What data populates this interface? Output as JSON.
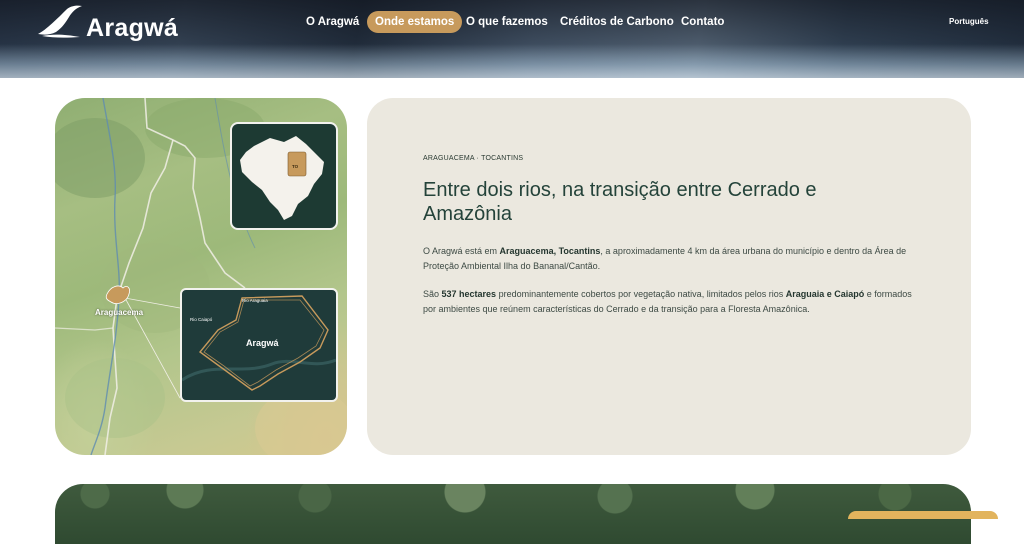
{
  "brand": {
    "name": "Aragwá"
  },
  "nav": {
    "items": [
      {
        "label": "O Aragwá",
        "active": false
      },
      {
        "label": "Onde estamos",
        "active": true
      },
      {
        "label": "O que fazemos",
        "active": false
      },
      {
        "label": "Créditos de Carbono",
        "active": false
      },
      {
        "label": "Contato",
        "active": false
      }
    ],
    "language": "Português"
  },
  "colors": {
    "accent": "#c79a5c",
    "headline": "#24433a",
    "card_bg": "#ebe8df",
    "inset_bg": "#1d3a33"
  },
  "map": {
    "city_label": "Araguacema",
    "local_title": "Aragwá",
    "river_labels": [
      "Rio Araguaia",
      "Rio Caiapó"
    ],
    "state_badge": "TO"
  },
  "section": {
    "eyebrow": "ARAGUACEMA · TOCANTINS",
    "headline": "Entre dois rios, na transição entre Cerrado e Amazônia",
    "p1": {
      "a": "O Aragwá está em ",
      "b": "Araguacema, Tocantins",
      "c": ", a aproximadamente 4 km da área urbana do município e dentro da Área de Proteção Ambiental Ilha do Bananal/Cantão."
    },
    "p2": {
      "a": "São ",
      "b": "537 hectares",
      "c": " predominantemente cobertos por vegetação nativa, limitados pelos rios ",
      "d": "Araguaia e Caiapó",
      "e": " e formados por ambientes que reúnem características do Cerrado e da transição para a Floresta Amazônica."
    }
  }
}
